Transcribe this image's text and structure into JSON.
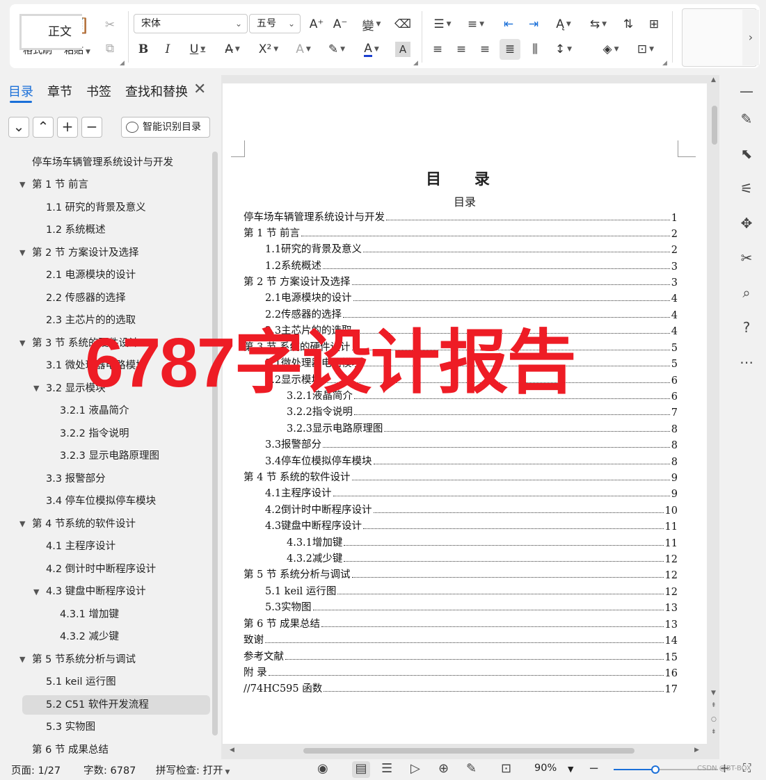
{
  "ribbon": {
    "format_painter": "格式刷",
    "paste": "粘贴",
    "font_name": "宋体",
    "font_size": "五号",
    "style_current": "正文"
  },
  "nav": {
    "tabs": [
      "目录",
      "章节",
      "书签",
      "查找和替换"
    ],
    "smart_toc": "智能识别目录",
    "items": [
      "停车场车辆管理系统设计与开发",
      "第 1 节  前言",
      "1.1 研究的背景及意义",
      "1.2 系统概述",
      "第 2 节    方案设计及选择",
      "2.1 电源模块的设计",
      "2.2 传感器的选择",
      "2.3 主芯片的的选取",
      "第 3 节  系统的硬件设计",
      "3.1 微处理器电路模块",
      "3.2 显示模块",
      "3.2.1 液晶简介",
      "3.2.2 指令说明",
      "3.2.3 显示电路原理图",
      "3.3 报警部分",
      "3.4 停车位模拟停车模块",
      "第 4 节系统的软件设计",
      "4.1 主程序设计",
      "4.2 倒计时中断程序设计",
      "4.3 键盘中断程序设计",
      "4.3.1 增加键",
      "4.3.2 减少键",
      "第 5 节系统分析与调试",
      "5.1 keil 运行图",
      "5.2 C51 软件开发流程",
      "5.3 实物图",
      "第 6 节  成果总结"
    ]
  },
  "document": {
    "title": "目 录",
    "subtitle": "目录",
    "toc": [
      {
        "text": "停车场车辆管理系统设计与开发",
        "page": "1"
      },
      {
        "text": "第 1 节  前言",
        "page": "2"
      },
      {
        "text": "1.1研究的背景及意义",
        "page": "2"
      },
      {
        "text": "1.2系统概述",
        "page": "3"
      },
      {
        "text": "第 2 节    方案设计及选择",
        "page": "3"
      },
      {
        "text": "2.1电源模块的设计",
        "page": "4"
      },
      {
        "text": "2.2传感器的选择",
        "page": "4"
      },
      {
        "text": "2.3主芯片的的选取",
        "page": "4"
      },
      {
        "text": "第 3 节  系统的硬件设计",
        "page": "5"
      },
      {
        "text": "3.1微处理器电路模块",
        "page": "5"
      },
      {
        "text": "3.2显示模块",
        "page": "6"
      },
      {
        "text": "3.2.1液晶简介",
        "page": "6"
      },
      {
        "text": "3.2.2指令说明",
        "page": "7"
      },
      {
        "text": "3.2.3显示电路原理图",
        "page": "8"
      },
      {
        "text": "3.3报警部分",
        "page": "8"
      },
      {
        "text": "3.4停车位模拟停车模块",
        "page": "8"
      },
      {
        "text": "第 4 节  系统的软件设计",
        "page": "9"
      },
      {
        "text": "4.1主程序设计",
        "page": "9"
      },
      {
        "text": "4.2倒计时中断程序设计",
        "page": "10"
      },
      {
        "text": "4.3键盘中断程序设计",
        "page": "11"
      },
      {
        "text": "4.3.1增加键",
        "page": "11"
      },
      {
        "text": "4.3.2减少键",
        "page": "12"
      },
      {
        "text": "第 5 节  系统分析与调试",
        "page": "12"
      },
      {
        "text": "5.1 keil 运行图",
        "page": "12"
      },
      {
        "text": "5.3实物图",
        "page": "13"
      },
      {
        "text": "第 6 节  成果总结",
        "page": "13"
      },
      {
        "text": "致谢",
        "page": "14"
      },
      {
        "text": "参考文献",
        "page": "15"
      },
      {
        "text": "附  录",
        "page": "16"
      },
      {
        "text": "//74HC595 函数",
        "page": "17"
      }
    ]
  },
  "overlay_text": "6787字设计报告",
  "status": {
    "page": "页面: 1/27",
    "words": "字数: 6787",
    "spell": "拼写检查: 打开",
    "zoom": "90%",
    "zoom_fraction": 0.4
  },
  "watermark": "CSDN @BT-BOX"
}
